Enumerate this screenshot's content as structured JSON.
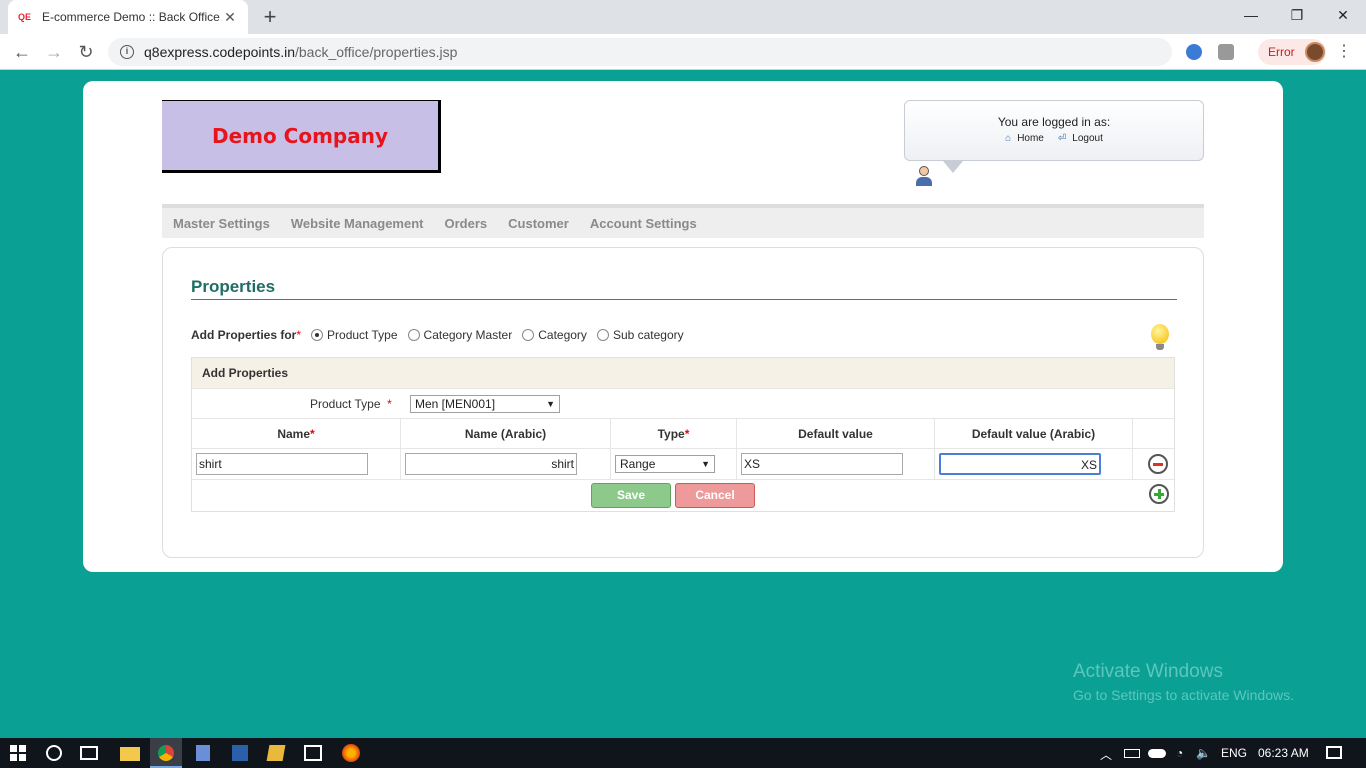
{
  "browser": {
    "tab_title": "E-commerce Demo :: Back Office",
    "favicon_text": "QE",
    "url_host": "q8express.codepoints.in",
    "url_path": "/back_office/properties.jsp",
    "error_label": "Error"
  },
  "header": {
    "company_name": "Demo Company",
    "logged_in_text": "You are logged in as:",
    "home_label": "Home",
    "logout_label": "Logout"
  },
  "menu": {
    "items": [
      "Master Settings",
      "Website Management",
      "Orders",
      "Customer",
      "Account Settings"
    ]
  },
  "properties": {
    "title": "Properties",
    "add_for_label": "Add Properties for",
    "required_mark": "*",
    "options": [
      {
        "label": "Product Type",
        "selected": true
      },
      {
        "label": "Category Master",
        "selected": false
      },
      {
        "label": "Category",
        "selected": false
      },
      {
        "label": "Sub category",
        "selected": false
      }
    ],
    "section_title": "Add Properties",
    "product_type_label": "Product Type",
    "product_type_value": "Men [MEN001]",
    "columns": {
      "name": "Name",
      "name_arabic": "Name (Arabic)",
      "type": "Type",
      "default_value": "Default value",
      "default_value_arabic": "Default value (Arabic)"
    },
    "row": {
      "name": "shirt",
      "name_arabic": "shirt",
      "type": "Range",
      "default_value": "XS",
      "default_value_arabic": "XS"
    },
    "save_label": "Save",
    "cancel_label": "Cancel"
  },
  "watermark": {
    "line1": "Activate Windows",
    "line2": "Go to Settings to activate Windows."
  },
  "taskbar": {
    "lang": "ENG",
    "time": "06:23 AM"
  },
  "colors": {
    "page_bg": "#0aa094",
    "title_teal": "#1f6e64",
    "company_red": "#e8141b",
    "logo_bg": "#c8bfe7",
    "save_green": "#8cc98b",
    "cancel_red": "#ee9a9a"
  }
}
